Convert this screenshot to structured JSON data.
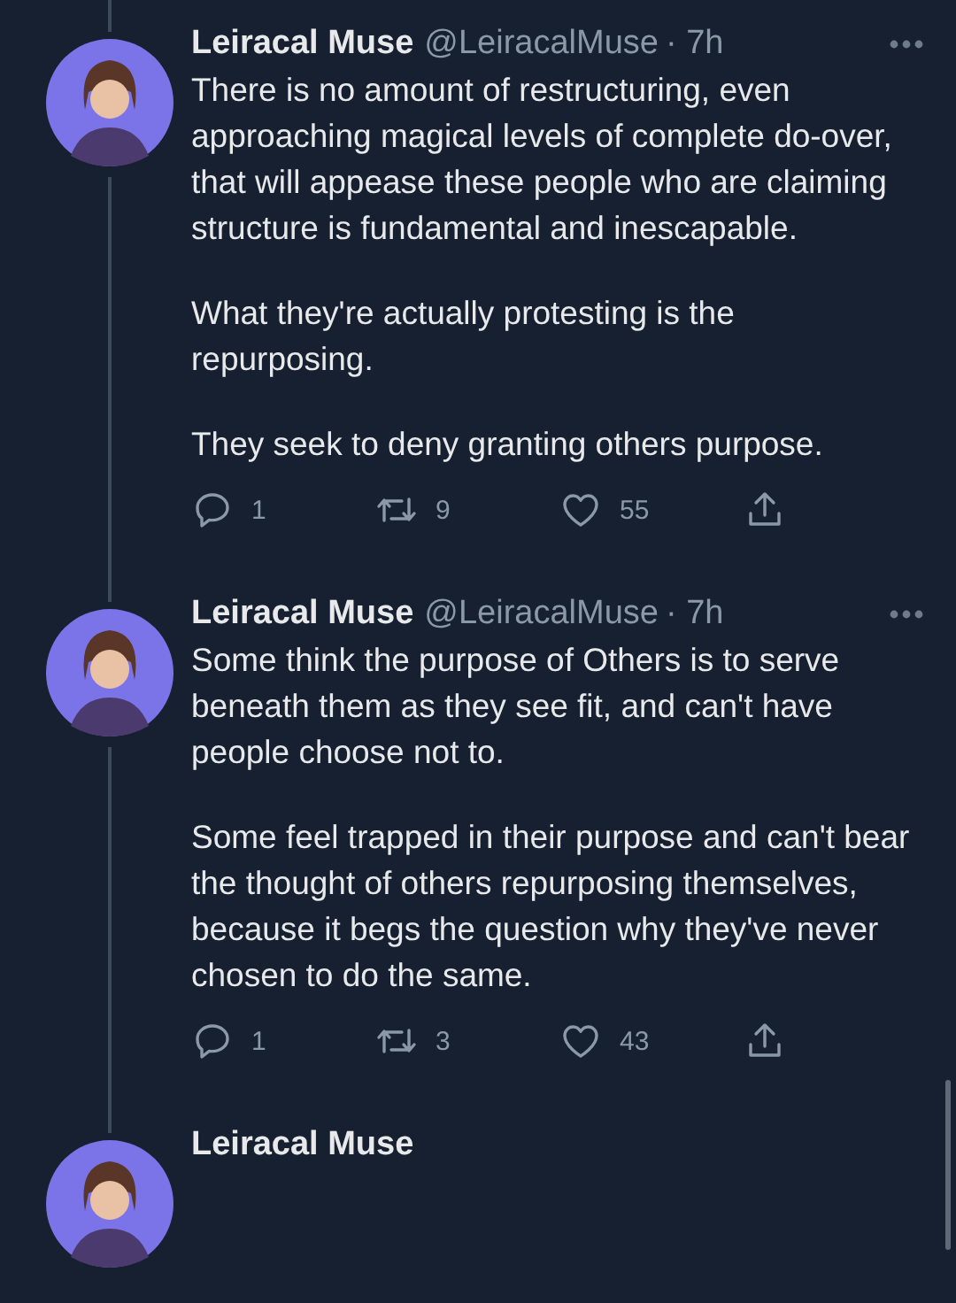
{
  "tweets": [
    {
      "name": "Leiracal Muse",
      "handle": "@LeiracalMuse",
      "time": "· 7h",
      "paragraphs": [
        "There is no amount of restructuring, even approaching magical levels of complete do-over, that will appease these people who are claiming structure is fundamental and inescapable.",
        "What they're actually protesting is the repurposing.",
        "They seek to deny granting others purpose."
      ],
      "replies": "1",
      "retweets": "9",
      "likes": "55"
    },
    {
      "name": "Leiracal Muse",
      "handle": "@LeiracalMuse",
      "time": "· 7h",
      "paragraphs": [
        "Some think the purpose of Others is to serve beneath them as they see fit, and can't have people choose not to.",
        "Some feel trapped in their purpose and can't bear the thought of others repurposing themselves, because it begs the question why they've never chosen to do the same."
      ],
      "replies": "1",
      "retweets": "3",
      "likes": "43"
    },
    {
      "name": "Leiracal Muse"
    }
  ]
}
